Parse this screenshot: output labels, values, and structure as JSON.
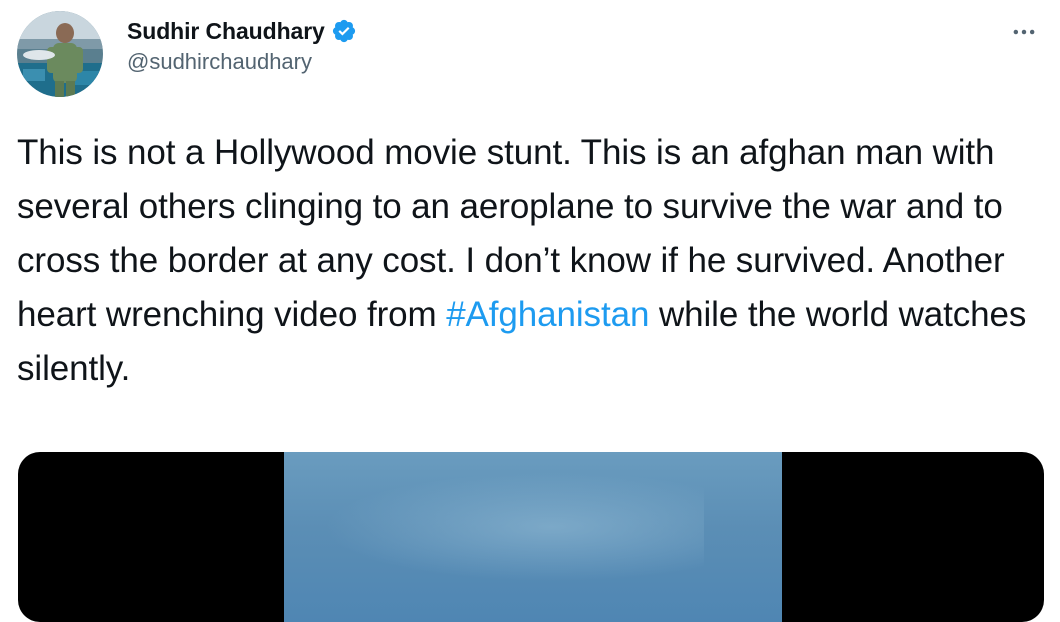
{
  "author": {
    "display_name": "Sudhir Chaudhary",
    "handle": "@sudhirchaudhary",
    "verified": true,
    "avatar_icon": "profile-photo"
  },
  "more_icon": "more-horizontal-icon",
  "tweet": {
    "text_before": "This is not a Hollywood movie stunt. This is an afghan man with several others clinging to an aeroplane to survive the war and to cross the border at any cost. I don’t know if he survived. Another heart wrenching video from ",
    "hashtag": "#Afghanistan",
    "text_after": " while the world watches silently."
  },
  "media": {
    "type": "video",
    "letterbox_color": "#000000",
    "sky_color": "#5b8eb5"
  },
  "colors": {
    "text": "#0f1419",
    "secondary": "#536471",
    "accent": "#1d9bf0"
  }
}
